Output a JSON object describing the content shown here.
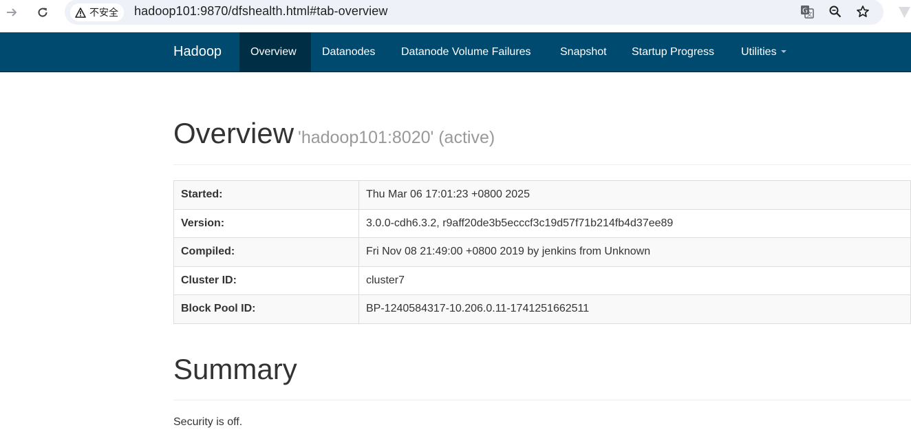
{
  "browser": {
    "security_label": "不安全",
    "url": "hadoop101:9870/dfshealth.html#tab-overview"
  },
  "navbar": {
    "brand": "Hadoop",
    "items": [
      {
        "label": "Overview",
        "active": true
      },
      {
        "label": "Datanodes"
      },
      {
        "label": "Datanode Volume Failures"
      },
      {
        "label": "Snapshot"
      },
      {
        "label": "Startup Progress"
      },
      {
        "label": "Utilities"
      }
    ]
  },
  "overview": {
    "title": "Overview",
    "subtitle": "'hadoop101:8020' (active)",
    "rows": [
      {
        "key": "Started:",
        "value": "Thu Mar 06 17:01:23 +0800 2025"
      },
      {
        "key": "Version:",
        "value": "3.0.0-cdh6.3.2, r9aff20de3b5ecccf3c19d57f71b214fb4d37ee89"
      },
      {
        "key": "Compiled:",
        "value": "Fri Nov 08 21:49:00 +0800 2019 by jenkins from Unknown"
      },
      {
        "key": "Cluster ID:",
        "value": "cluster7"
      },
      {
        "key": "Block Pool ID:",
        "value": "BP-1240584317-10.206.0.11-1741251662511"
      }
    ]
  },
  "summary": {
    "title": "Summary",
    "security_text": "Security is off."
  },
  "colors": {
    "navbar_bg": "#004a70",
    "navbar_active_bg": "#002e45",
    "omnibox_bg": "#eef2f8"
  }
}
